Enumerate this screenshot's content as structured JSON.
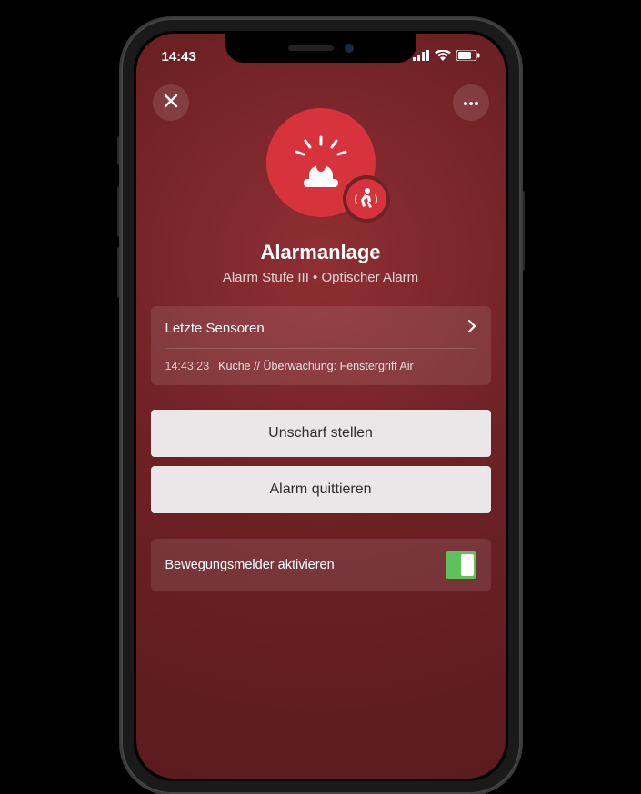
{
  "statusbar": {
    "time": "14:43"
  },
  "header": {
    "close_sr": "Schließen",
    "more_sr": "Mehr"
  },
  "main": {
    "title": "Alarmanlage",
    "subtitle": "Alarm Stufe III • Optischer Alarm"
  },
  "sensors": {
    "header": "Letzte Sensoren",
    "items": [
      {
        "time": "14:43:23",
        "text": "Küche // Überwachung: Fenstergriff Air"
      }
    ]
  },
  "actions": {
    "disarm": "Unscharf stellen",
    "ack": "Alarm quittieren"
  },
  "toggle": {
    "label": "Bewegungsmelder aktivieren",
    "on": true
  },
  "colors": {
    "accent": "#d7333d",
    "toggle_on": "#5ec15e"
  }
}
